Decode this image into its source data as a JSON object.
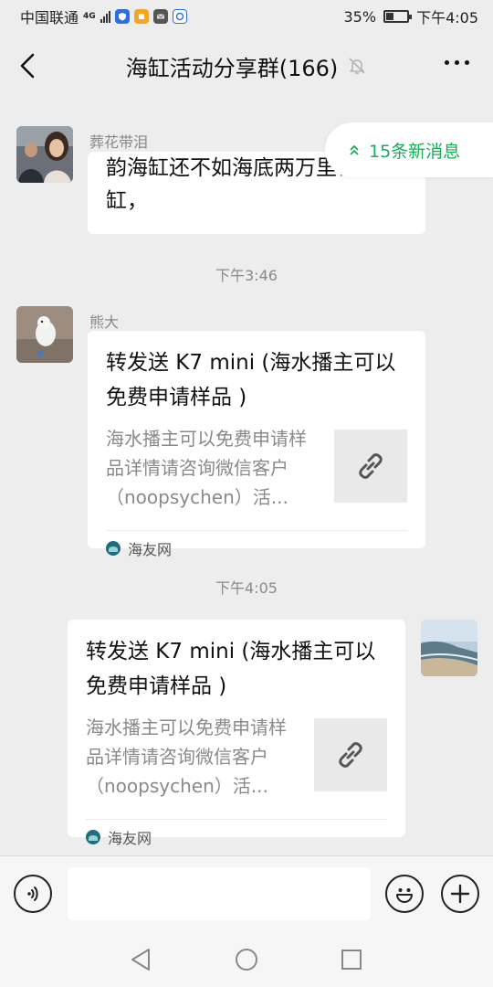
{
  "status_bar": {
    "carrier": "中国联通",
    "network": "4G",
    "battery": "35%",
    "battery_level": 0.35,
    "time": "下午4:05"
  },
  "header": {
    "title": "海缸活动分享群(166)",
    "icons": [
      "back-arrow-icon",
      "mute-bell-icon",
      "more-icon"
    ]
  },
  "new_messages": {
    "label": "15条新消息"
  },
  "messages": [
    {
      "sender": "葬花带泪",
      "text": "韵海缸还不如海底两万里订做的缸，"
    },
    {
      "time": "下午3:46",
      "sender": "熊大",
      "card": {
        "title": "转发送 K7 mini (海水播主可以免费申请样品 )",
        "description": "海水播主可以免费申请样品详情请咨询微信客户（noopsychen）活...",
        "source": "海友网"
      }
    },
    {
      "time": "下午4:05",
      "card": {
        "title": "转发送 K7 mini (海水播主可以免费申请样品 )",
        "description": "海水播主可以免费申请样品详情请咨询微信客户（noopsychen）活...",
        "source": "海友网"
      }
    }
  ],
  "input": {
    "value": "",
    "placeholder": ""
  },
  "colors": {
    "background": "#ededed",
    "accent_green": "#1aad5a",
    "bubble": "#ffffff"
  }
}
